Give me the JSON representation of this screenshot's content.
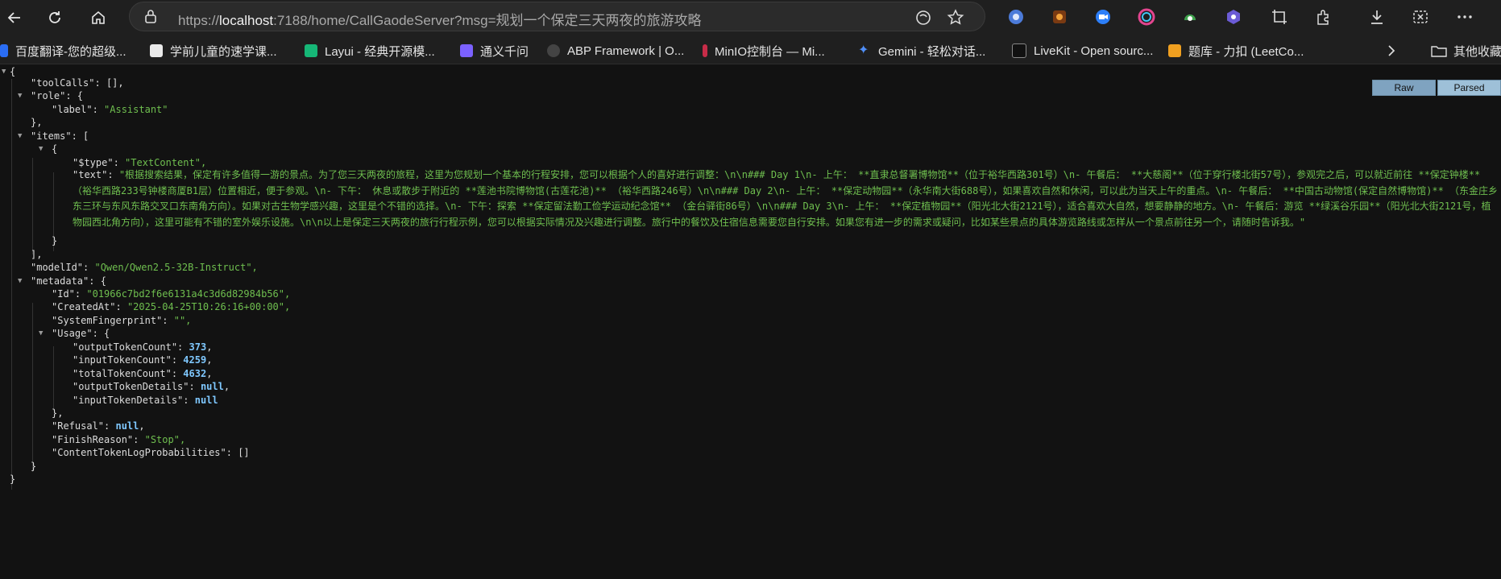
{
  "browser": {
    "url_prefix": "https://",
    "url_host": "localhost",
    "url_rest": ":7188/home/CallGaodeServer?msg=规划一个保定三天两夜的旅游攻略"
  },
  "bookmarks": [
    {
      "label": "百度翻译-您的超级...",
      "color": "#2a6df4"
    },
    {
      "label": "学前儿童的速学课...",
      "color": "#eaeaea"
    },
    {
      "label": "Layui - 经典开源模...",
      "color": "#16b777"
    },
    {
      "label": "通义千问",
      "color": "#7b61ff"
    },
    {
      "label": "ABP Framework | O...",
      "color": "#444444"
    },
    {
      "label": "MinIO控制台 — Mi...",
      "color": "#c72c48"
    },
    {
      "label": "Gemini - 轻松对话...",
      "color": "#4f8ef7"
    },
    {
      "label": "LiveKit - Open sourc...",
      "color": "#111111"
    },
    {
      "label": "题库 - 力扣 (LeetCo...",
      "color": "#f0a020"
    },
    {
      "label": "其他收藏",
      "color": "#cccccc"
    }
  ],
  "view_buttons": {
    "raw": "Raw",
    "parsed": "Parsed"
  },
  "json": {
    "open_brace": "{",
    "toolCalls_key": "\"toolCalls\"",
    "toolCalls_val": "[],",
    "role_key": "\"role\"",
    "label_key": "\"label\"",
    "label_val": "\"Assistant\"",
    "items_key": "\"items\"",
    "type_key": "\"$type\"",
    "type_val": "\"TextContent\",",
    "text_key": "\"text\"",
    "text_val": "\"根据搜索结果，保定有许多值得一游的景点。为了您三天两夜的旅程，这里为您规划一个基本的行程安排，您可以根据个人的喜好进行调整：\\n\\n### Day 1\\n- 上午： **直隶总督署博物馆**（位于裕华西路301号）\\n- 午餐后： **大慈阁**（位于穿行楼北街57号），参观完之后，可以就近前往 **保定钟楼** （裕华西路233号钟楼商厦B1层）位置相近，便于参观。\\n- 下午： 休息或散步于附近的 **莲池书院博物馆(古莲花池)** （裕华西路246号）\\n\\n### Day 2\\n- 上午： **保定动物园**（永华南大街688号），如果喜欢自然和休闲，可以此为当天上午的重点。\\n- 午餐后： **中国古动物馆(保定自然博物馆)** （东金庄乡东三环与东风东路交叉口东南角方向）。如果对古生物学感兴趣，这里是个不错的选择。\\n- 下午：探索 **保定留法勤工俭学运动纪念馆** （金台驿街86号）\\n\\n### Day 3\\n- 上午： **保定植物园**（阳光北大街2121号），适合喜欢大自然，想要静静的地方。\\n- 午餐后：游览 **绿溪谷乐园**（阳光北大街2121号，植物园西北角方向），这里可能有不错的室外娱乐设施。\\n\\n以上是保定三天两夜的旅行行程示例，您可以根据实际情况及兴趣进行调整。旅行中的餐饮及住宿信息需要您自行安排。如果您有进一步的需求或疑问，比如某些景点的具体游览路线或怎样从一个景点前往另一个，请随时告诉我。\"",
    "modelId_key": "\"modelId\"",
    "modelId_val": "\"Qwen/Qwen2.5-32B-Instruct\",",
    "metadata_key": "\"metadata\"",
    "id_key": "\"Id\"",
    "id_val": "\"01966c7bd2f6e6131a4c3d6d82984b56\",",
    "created_key": "\"CreatedAt\"",
    "created_val": "\"2025-04-25T10:26:16+00:00\",",
    "fp_key": "\"SystemFingerprint\"",
    "fp_val": "\"\",",
    "usage_key": "\"Usage\"",
    "out_key": "\"outputTokenCount\"",
    "out_val": "373",
    "in_key": "\"inputTokenCount\"",
    "in_val": "4259",
    "total_key": "\"totalTokenCount\"",
    "total_val": "4632",
    "outd_key": "\"outputTokenDetails\"",
    "ind_key": "\"inputTokenDetails\"",
    "null_val": "null",
    "refusal_key": "\"Refusal\"",
    "finish_key": "\"FinishReason\"",
    "finish_val": "\"Stop\",",
    "logprob_key": "\"ContentTokenLogProbabilities\"",
    "logprob_val": "[]"
  }
}
